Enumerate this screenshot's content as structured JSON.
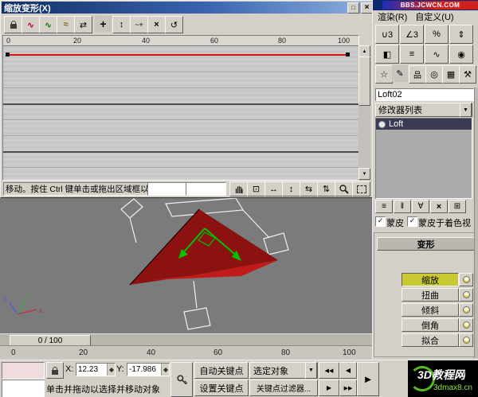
{
  "colors": {
    "titlebar_blue": "#16388e",
    "panel_gray": "#d4d0c8",
    "viewport_gray": "#7b7b7b",
    "curve_red": "#dd1111",
    "active_deform_yellow": "#c9c932",
    "stack_selected": "#3a3a55",
    "banner_red": "#cc2020",
    "logo_green": "#8de63c"
  },
  "icons": {
    "check": "✓",
    "dropdown_arrow": "▼",
    "scrollbar_up": "▲",
    "scrollbar_down": "▼"
  },
  "deform_dialog": {
    "title": "缩放变形(X)",
    "titlebar": {
      "maximize_glyph": "□",
      "close_glyph": "×"
    },
    "toolbar": [
      {
        "name": "make-symmetrical"
      },
      {
        "name": "display-x-axis",
        "glyph": "∿"
      },
      {
        "name": "display-y-axis",
        "glyph": "∿"
      },
      {
        "name": "display-xy-axes",
        "glyph": "≈"
      },
      {
        "name": "swap-deform-curves",
        "glyph": "⇄"
      },
      {
        "name": "move-control-point",
        "glyph": "+"
      },
      {
        "name": "scale-control-point",
        "glyph": "↕"
      },
      {
        "name": "insert-corner-point",
        "glyph": "~+"
      },
      {
        "name": "delete-control-point",
        "glyph": "×"
      },
      {
        "name": "reset-curve",
        "glyph": "↺"
      }
    ],
    "ruler_ticks": [
      "0",
      "20",
      "40",
      "60",
      "80",
      "100"
    ],
    "graph": {
      "type": "line",
      "curve": "scale-deformation-curve",
      "control_points_x": [
        0,
        100
      ],
      "control_points_value": [
        100,
        100
      ]
    },
    "status_text": "移动。按住 Ctrl 键单击或拖出区域框以选",
    "coord_field_1": "",
    "coord_field_2": "",
    "nav_buttons": [
      {
        "name": "pan"
      },
      {
        "name": "zoom-extents",
        "glyph": "⊡"
      },
      {
        "name": "zoom-horizontal-extents",
        "glyph": "↔"
      },
      {
        "name": "zoom-vertical-extents",
        "glyph": "↕"
      },
      {
        "name": "zoom-horizontally",
        "glyph": "⇆"
      },
      {
        "name": "zoom-vertically",
        "glyph": "⇅"
      },
      {
        "name": "zoom"
      },
      {
        "name": "zoom-region"
      }
    ]
  },
  "menubar": {
    "items": [
      "渲染(R)",
      "自定义(U)"
    ]
  },
  "banner_text": "BBS.JCWCN.COM",
  "main_toolbar": [
    {
      "name": "snap-toggle",
      "glyph": "∪3"
    },
    {
      "name": "angle-snap-toggle",
      "glyph": "∠3"
    },
    {
      "name": "percent-snap-toggle",
      "glyph": "%"
    },
    {
      "name": "spinner-snap-toggle",
      "glyph": "⇕"
    },
    {
      "name": "mirror",
      "glyph": "◧"
    },
    {
      "name": "align",
      "glyph": "≡"
    },
    {
      "name": "curve-editor",
      "glyph": "∿"
    },
    {
      "name": "material-editor",
      "glyph": "◉"
    }
  ],
  "command_panel": {
    "tabs": [
      {
        "name": "create",
        "glyph": "☆"
      },
      {
        "name": "modify",
        "glyph": "✎",
        "active": true
      },
      {
        "name": "hierarchy",
        "glyph": "品"
      },
      {
        "name": "motion",
        "glyph": "◎"
      },
      {
        "name": "display",
        "glyph": "▦"
      },
      {
        "name": "utilities",
        "glyph": "⚒"
      }
    ],
    "object_name": "Loft02",
    "modifier_list_label": "修改器列表",
    "stack": [
      {
        "label": "Loft",
        "selected": true
      }
    ],
    "stack_tools": [
      {
        "name": "pin-stack",
        "glyph": "≡"
      },
      {
        "name": "show-end-result",
        "glyph": "‖"
      },
      {
        "name": "make-unique",
        "glyph": "∀"
      },
      {
        "name": "remove-modifier",
        "glyph": "×"
      },
      {
        "name": "configure-modifier-sets",
        "glyph": "⊞"
      }
    ],
    "skin_label": "蒙皮",
    "skin_shaded_label": "蒙皮于着色视",
    "deformations": {
      "rollout_title": "变形",
      "buttons": [
        {
          "label": "缩放",
          "active": true
        },
        {
          "label": "扭曲",
          "active": false
        },
        {
          "label": "倾斜",
          "active": false
        },
        {
          "label": "倒角",
          "active": false
        },
        {
          "label": "拟合",
          "active": false
        }
      ]
    }
  },
  "timeline": {
    "slider_label": "0 / 100",
    "ticks": [
      "0",
      "20",
      "40",
      "60",
      "80",
      "100"
    ]
  },
  "status_bar": {
    "x_label": "X:",
    "x_value": "12.23",
    "y_label": "Y:",
    "y_value": "-17.986",
    "auto_key_label": "自动关键点",
    "selection_set_label": "选定对象",
    "set_key_label": "设置关键点",
    "key_filters_label": "关键点过滤器...",
    "prompt": "单击并拖动以选择并移动对象",
    "playback": {
      "go_start": "◀◀",
      "prev_frame": "◀",
      "next_frame": "▶",
      "go_end": "▶▶",
      "play": "►"
    }
  },
  "watermark": {
    "brand": "3D教程网",
    "site": "3dmax8.cn"
  }
}
